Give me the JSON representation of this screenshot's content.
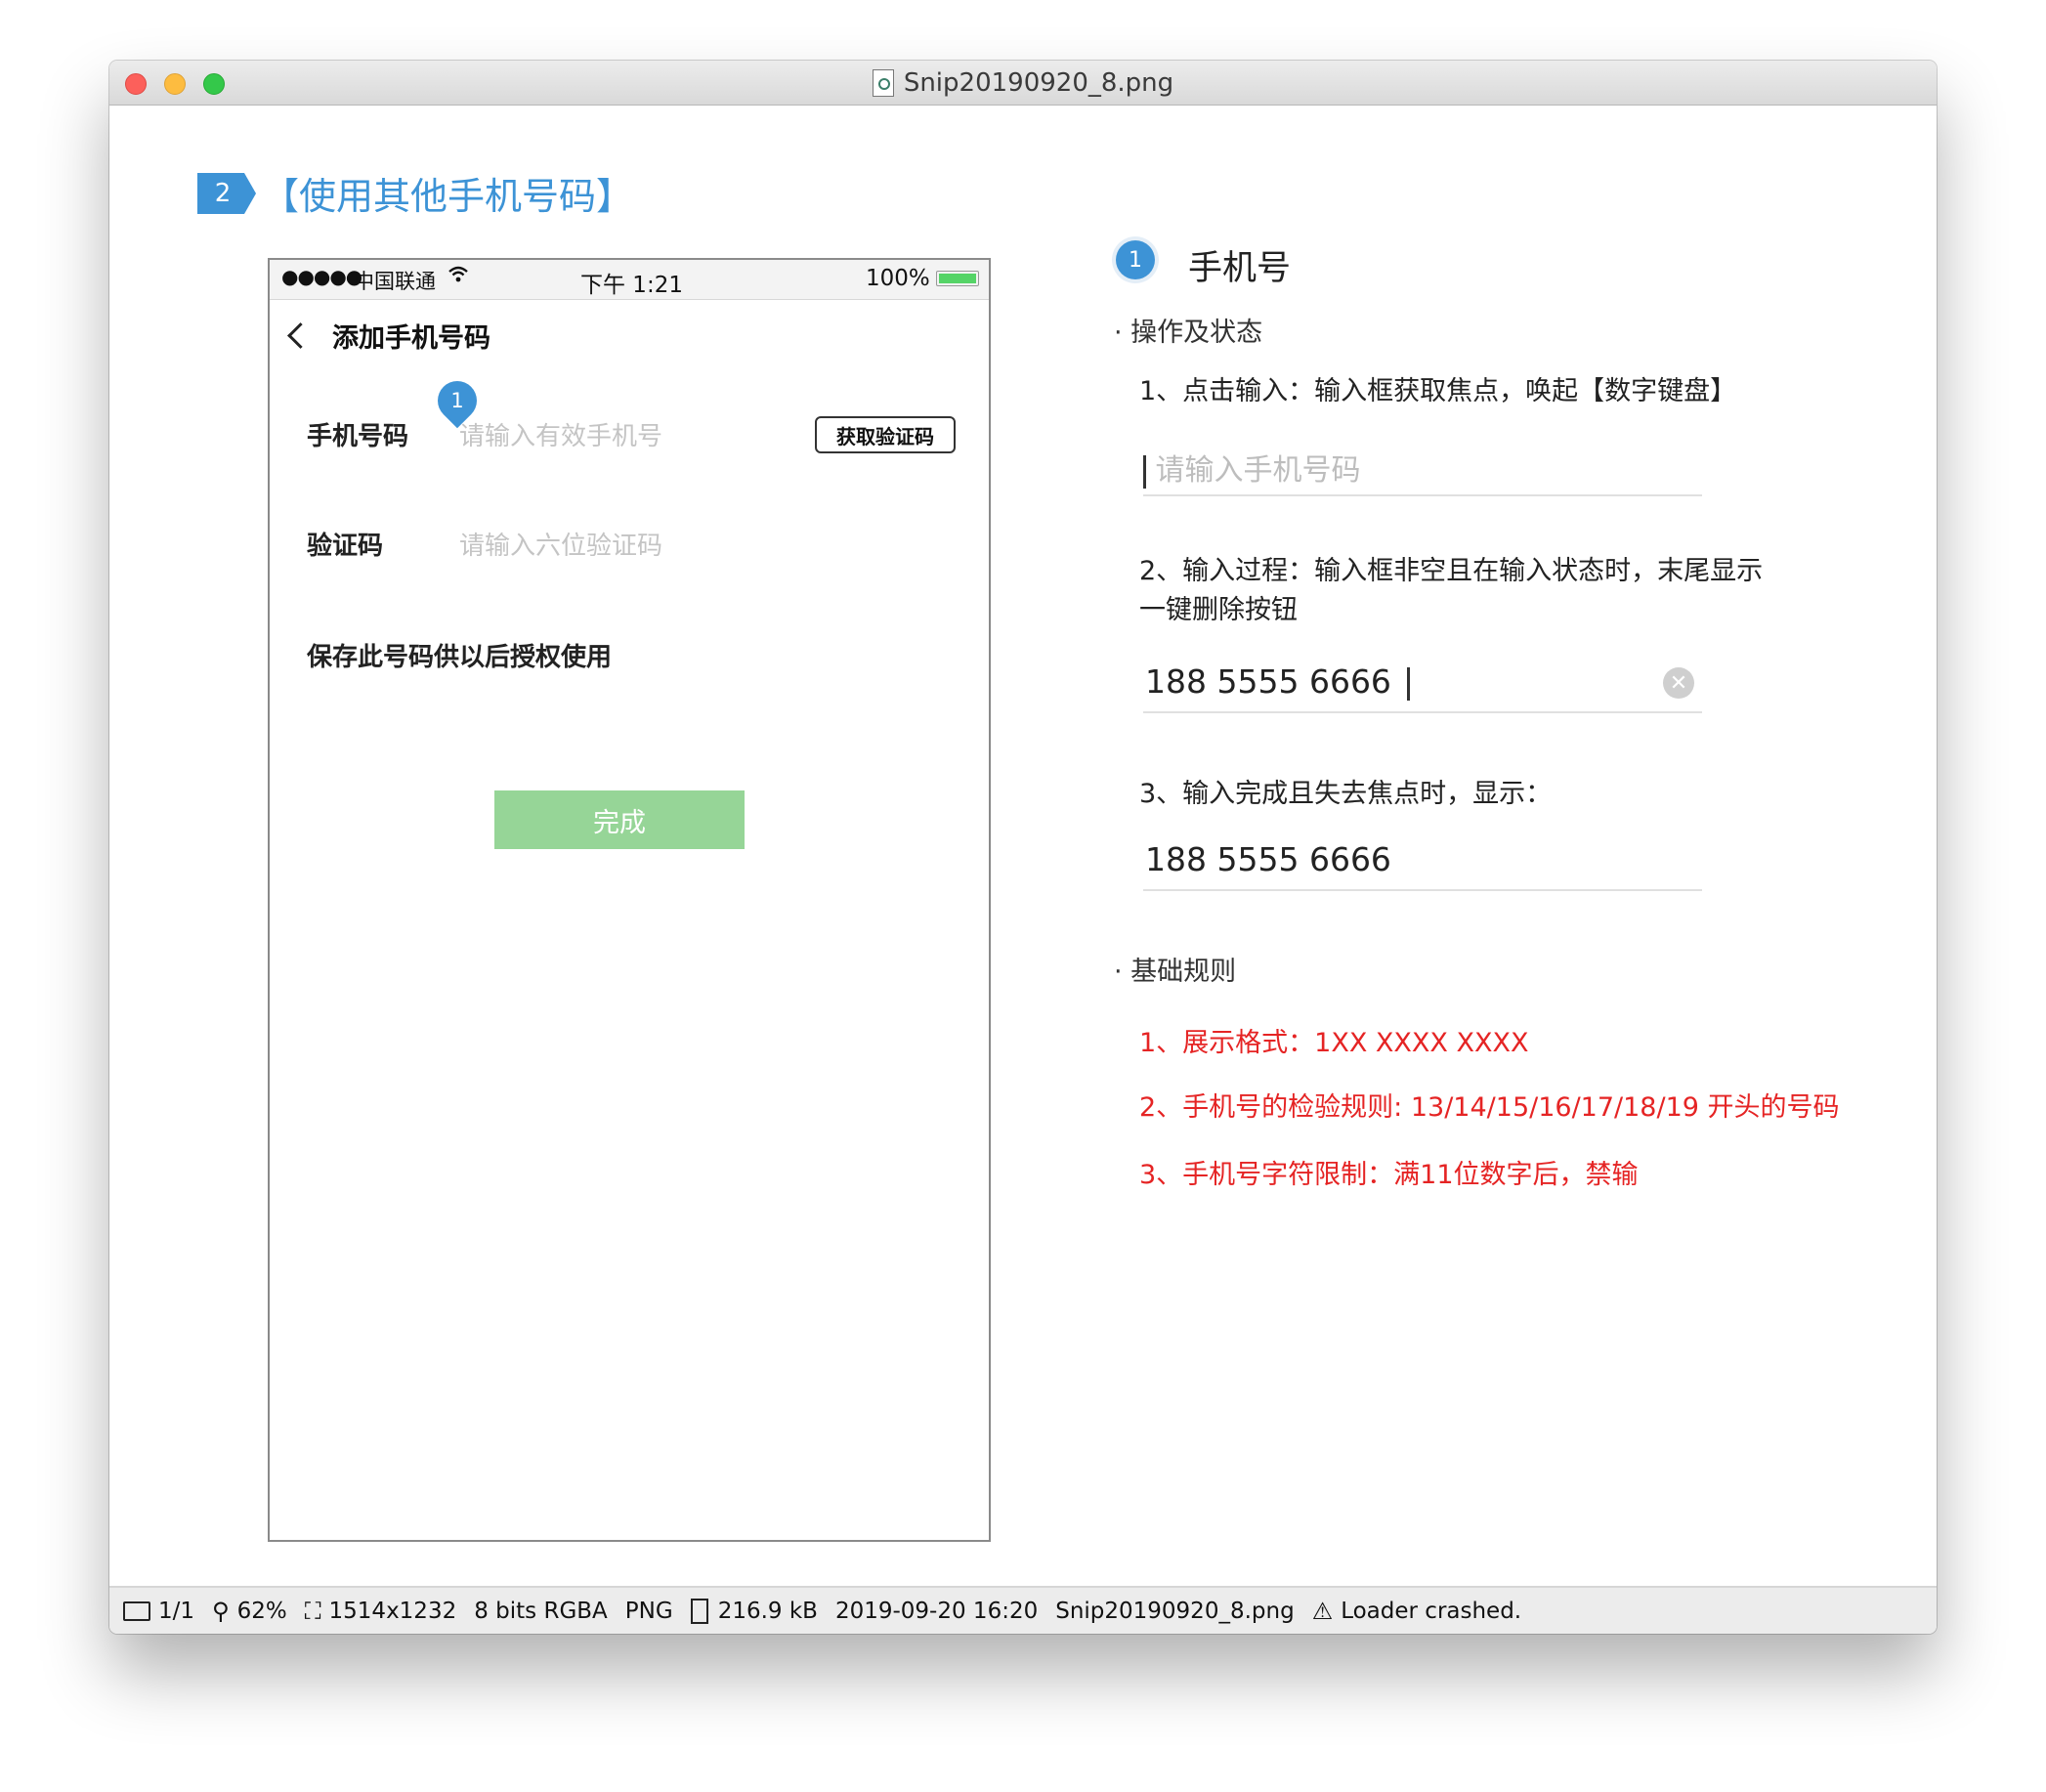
{
  "window": {
    "title": "Snip20190920_8.png"
  },
  "section": {
    "number": "2",
    "title": "【使用其他手机号码】"
  },
  "phone": {
    "statusbar": {
      "signal": "●●●●●",
      "carrier": "中国联通",
      "time": "下午 1:21",
      "battery": "100%"
    },
    "nav_title": "添加手机号码",
    "phone_label": "手机号码",
    "phone_placeholder": "请输入有效手机号",
    "get_code_button": "获取验证码",
    "pin_number": "1",
    "code_label": "验证码",
    "code_placeholder": "请输入六位验证码",
    "save_text": "保存此号码供以后授权使用",
    "done_button": "完成"
  },
  "spec": {
    "number": "1",
    "title": "手机号",
    "ops_heading": "· 操作及状态",
    "step1": "1、点击输入：输入框获取焦点，唤起【数字键盘】",
    "step1_placeholder": "请输入手机号码",
    "step2": "2、输入过程：输入框非空且在输入状态时，末尾显示一键删除按钮",
    "step2_value": "188 5555 6666",
    "step3": "3、输入完成且失去焦点时，显示：",
    "step3_value": "188 5555 6666",
    "rules_heading": "· 基础规则",
    "rules": [
      "1、展示格式：1XX XXXX XXXX",
      "2、手机号的检验规则: 13/14/15/16/17/18/19 开头的号码",
      "3、手机号字符限制：满11位数字后，禁输"
    ],
    "rule_color": "#e52424",
    "accent_color": "#3d93d6"
  },
  "statusbar": {
    "pages": "1/1",
    "zoom": "62%",
    "dimensions": "1514x1232",
    "color_mode": "8 bits RGBA",
    "format": "PNG",
    "file_size": "216.9 kB",
    "date": "2019-09-20 16:20",
    "filename": "Snip20190920_8.png",
    "warning": "Loader crashed."
  }
}
